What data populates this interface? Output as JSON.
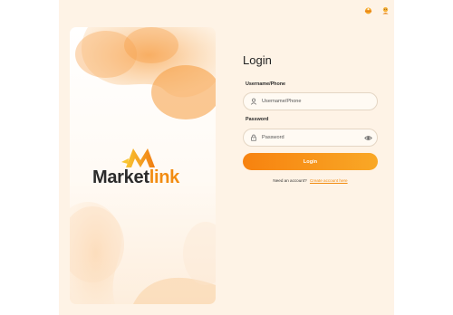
{
  "header": {
    "icon_left": "cloud-weather-icon",
    "icon_right": "user-profile-icon"
  },
  "brand": {
    "logo_icon": "marketlink-m-logo",
    "name_part1": "Market",
    "name_part2": "link",
    "colors": {
      "dark": "#2b2b2b",
      "accent": "#f28c11"
    }
  },
  "login": {
    "title": "Login",
    "username_label": "Username/Phone",
    "username_placeholder": "Username/Phone",
    "password_label": "Password",
    "password_placeholder": "Password",
    "submit_label": "Login",
    "signup_prompt": "Need an account?",
    "signup_link": "Create account here"
  }
}
